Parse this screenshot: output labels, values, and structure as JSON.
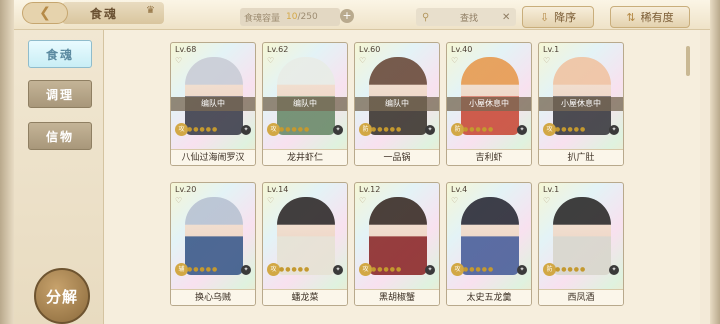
{
  "header": {
    "title": "食魂",
    "capacity_label": "食魂容量",
    "capacity_current": "10",
    "capacity_max": "/250",
    "search_placeholder": "查找",
    "sort_label": "降序",
    "rarity_label": "稀有度"
  },
  "sidebar": {
    "items": [
      {
        "label": "食魂",
        "active": true
      },
      {
        "label": "调理",
        "active": false
      },
      {
        "label": "信物",
        "active": false
      }
    ],
    "decompose_label": "分解"
  },
  "cards": [
    {
      "level": "Lv.68",
      "status": "编队中",
      "name": "八仙过海闹罗汉",
      "badge": "攻",
      "hair": "#c9ccd6",
      "robe": "#3d3f4c"
    },
    {
      "level": "Lv.62",
      "status": "编队中",
      "name": "龙井虾仁",
      "badge": "攻",
      "hair": "#e8ece6",
      "robe": "#6a8a6a"
    },
    {
      "level": "Lv.60",
      "status": "编队中",
      "name": "一品锅",
      "badge": "防",
      "hair": "#6a4a3a",
      "robe": "#3c3630"
    },
    {
      "level": "Lv.40",
      "status": "小屋休息中",
      "name": "吉利虾",
      "badge": "防",
      "hair": "#e79a4f",
      "robe": "#c94c3a"
    },
    {
      "level": "Lv.1",
      "status": "小屋休息中",
      "name": "扒广肚",
      "badge": "攻",
      "hair": "#f0c3a2",
      "robe": "#3a3a40"
    },
    {
      "level": "Lv.20",
      "status": "",
      "name": "换心乌贼",
      "badge": "辅",
      "hair": "#b8c2d2",
      "robe": "#3b5a8a"
    },
    {
      "level": "Lv.14",
      "status": "",
      "name": "蟠龙菜",
      "badge": "攻",
      "hair": "#2f2a2a",
      "robe": "#e6e2d4"
    },
    {
      "level": "Lv.12",
      "status": "",
      "name": "黑胡椒蟹",
      "badge": "攻",
      "hair": "#3a2c26",
      "robe": "#8c2a2a"
    },
    {
      "level": "Lv.4",
      "status": "",
      "name": "太史五龙羹",
      "badge": "攻",
      "hair": "#2a2a36",
      "robe": "#4a5f9a"
    },
    {
      "level": "Lv.1",
      "status": "",
      "name": "西凤酒",
      "badge": "防",
      "hair": "#2c2a2a",
      "robe": "#d8d6cc"
    }
  ]
}
